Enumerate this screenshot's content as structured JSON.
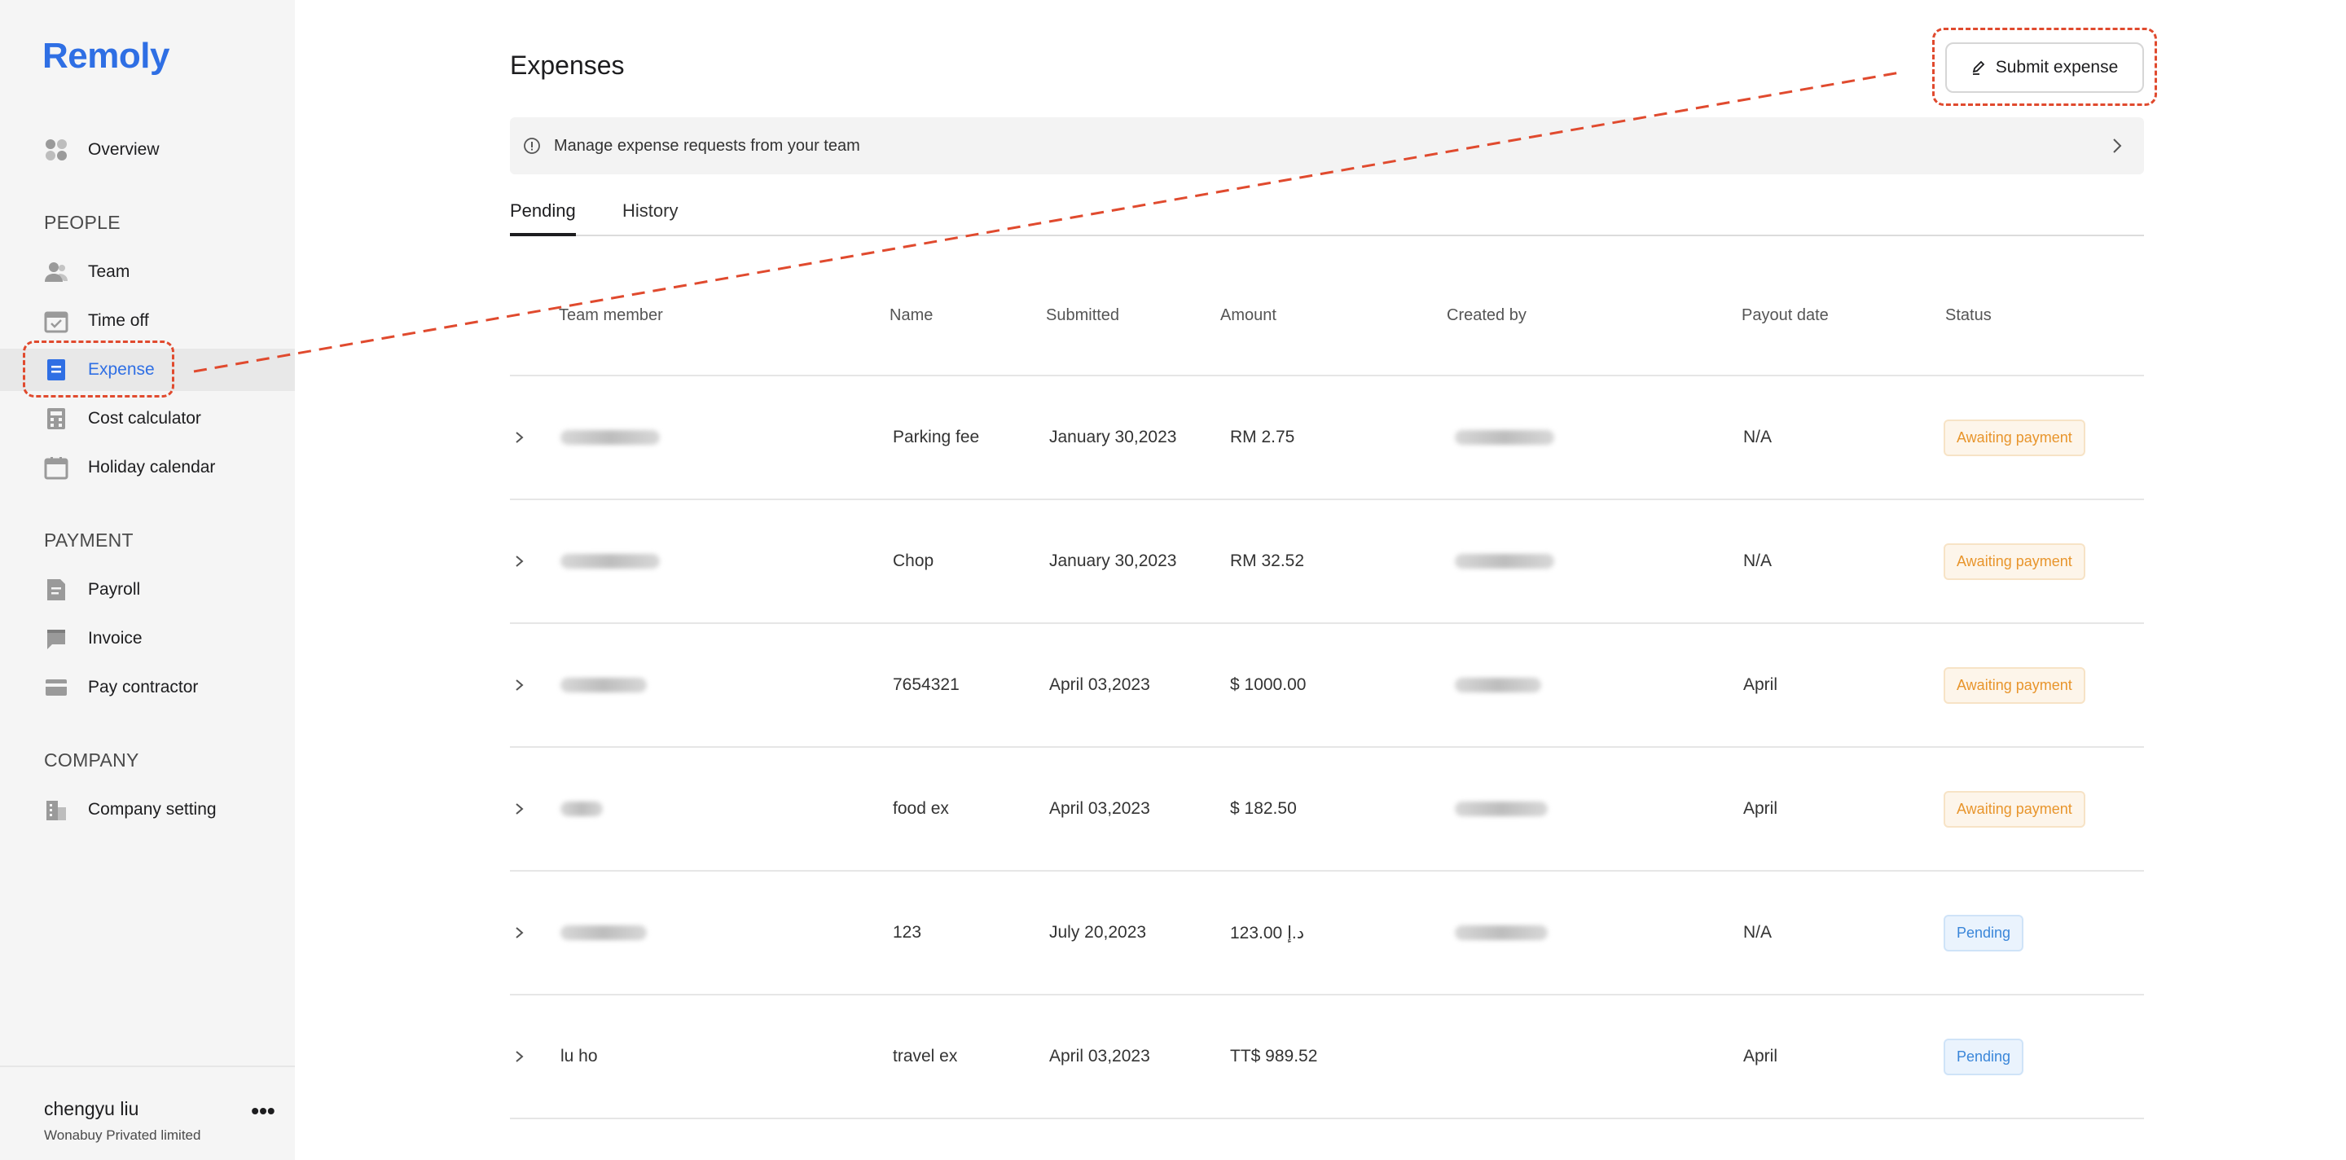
{
  "app": {
    "logo": "Remoly"
  },
  "sidebar": {
    "overview": "Overview",
    "sections": {
      "people": "PEOPLE",
      "payment": "PAYMENT",
      "company": "COMPANY"
    },
    "people_items": [
      "Team",
      "Time off",
      "Expense",
      "Cost calculator",
      "Holiday calendar"
    ],
    "payment_items": [
      "Payroll",
      "Invoice",
      "Pay contractor"
    ],
    "company_items": [
      "Company setting"
    ],
    "active_item": "Expense",
    "user": {
      "name": "chengyu liu",
      "company": "Wonabuy Privated limited",
      "more": "•••"
    }
  },
  "main": {
    "title": "Expenses",
    "submit_label": "Submit expense",
    "banner_text": "Manage expense requests from your team",
    "tabs": [
      {
        "label": "Pending",
        "active": true
      },
      {
        "label": "History",
        "active": false
      }
    ],
    "columns": [
      "Team member",
      "Name",
      "Submitted",
      "Amount",
      "Created by",
      "Payout date",
      "Status"
    ],
    "rows": [
      {
        "member": "",
        "name": "Parking fee",
        "submitted": "January 30,2023",
        "amount": "RM 2.75",
        "created_by": "",
        "payout": "N/A",
        "status": "Awaiting payment",
        "status_type": "awaiting"
      },
      {
        "member": "",
        "name": "Chop",
        "submitted": "January 30,2023",
        "amount": "RM 32.52",
        "created_by": "",
        "payout": "N/A",
        "status": "Awaiting payment",
        "status_type": "awaiting"
      },
      {
        "member": "",
        "name": "7654321",
        "submitted": "April 03,2023",
        "amount": "$ 1000.00",
        "created_by": "",
        "payout": "April",
        "status": "Awaiting payment",
        "status_type": "awaiting"
      },
      {
        "member": "",
        "name": "food ex",
        "submitted": "April 03,2023",
        "amount": "$ 182.50",
        "created_by": "",
        "payout": "April",
        "status": "Awaiting payment",
        "status_type": "awaiting"
      },
      {
        "member": "",
        "name": "123",
        "submitted": "July 20,2023",
        "amount": "123.00 د.إ",
        "created_by": "",
        "payout": "N/A",
        "status": "Pending",
        "status_type": "pending"
      },
      {
        "member": "lu ho",
        "name": "travel ex",
        "submitted": "April 03,2023",
        "amount": "TT$ 989.52",
        "created_by": "",
        "payout": "April",
        "status": "Pending",
        "status_type": "pending"
      }
    ]
  },
  "colors": {
    "brand": "#2f6fe4",
    "annotation": "#e04a2e",
    "awaiting": "#e8952c",
    "pending": "#3a86d9"
  }
}
